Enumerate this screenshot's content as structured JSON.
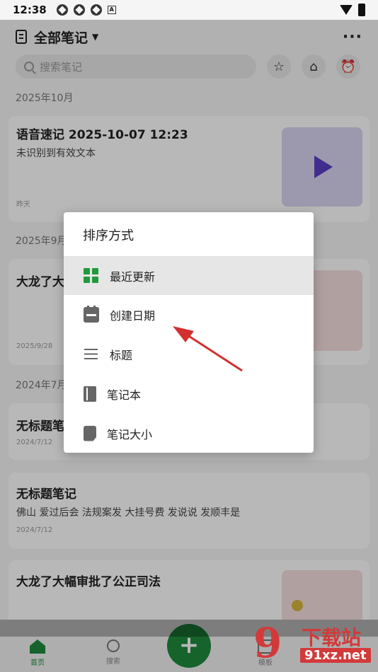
{
  "status_bar": {
    "time": "12:38"
  },
  "header": {
    "title": "全部笔记",
    "more": "···"
  },
  "search": {
    "placeholder": "搜索笔记"
  },
  "sections": [
    {
      "label": "2025年10月"
    },
    {
      "label": "2025年9月"
    },
    {
      "label": "2024年7月"
    }
  ],
  "notes": [
    {
      "title": "语音速记 2025-10-07 12:23",
      "subtitle": "未识别到有效文本",
      "date": "昨天"
    },
    {
      "title": "大龙了大",
      "date": "2025/9/28"
    },
    {
      "title": "无标题笔",
      "date": "2024/7/12"
    },
    {
      "title": "无标题笔记",
      "subtitle": "佛山 爱过后会 法规案发 大挂号费 发说说 发顺丰是",
      "date": "2024/7/12"
    },
    {
      "title": "大龙了大幅审批了公正司法"
    }
  ],
  "sort_dialog": {
    "title": "排序方式",
    "options": [
      {
        "label": "最近更新",
        "icon": "grid-icon",
        "selected": true
      },
      {
        "label": "创建日期",
        "icon": "calendar-icon",
        "selected": false
      },
      {
        "label": "标题",
        "icon": "menu-icon",
        "selected": false
      },
      {
        "label": "笔记本",
        "icon": "notebook-icon",
        "selected": false
      },
      {
        "label": "笔记大小",
        "icon": "file-size-icon",
        "selected": false
      }
    ]
  },
  "bottom_nav": {
    "home": "首页",
    "search": "搜索",
    "templates": "模板",
    "fab": "+"
  },
  "watermark": {
    "cn": "下载站",
    "url": "91xz.net",
    "logo": "9"
  },
  "colors": {
    "accent": "#1f8a3c",
    "arrow": "#d32f2f",
    "voice_thumb": "#d9d5f2",
    "play": "#5a3fc4"
  }
}
